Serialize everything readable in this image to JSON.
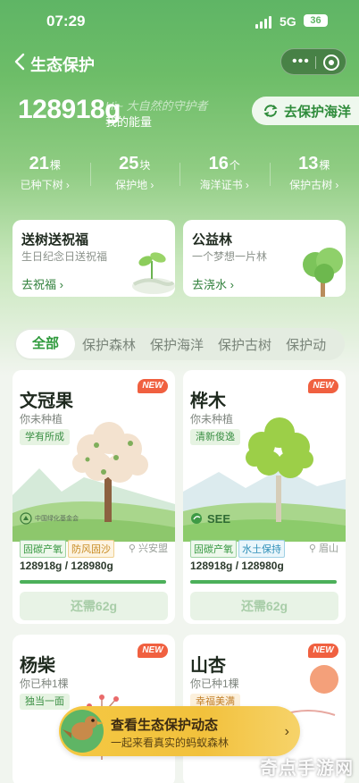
{
  "status": {
    "time": "07:29",
    "network": "5G",
    "battery": "36"
  },
  "nav": {
    "title": "生态保护"
  },
  "energy": {
    "value": "128918g",
    "greeting": "Hi~ 大自然的守护者",
    "label": "我的能量"
  },
  "ocean_button": {
    "label": "去保护海洋"
  },
  "stats": [
    {
      "value": "21",
      "unit": "棵",
      "label": "已种下树"
    },
    {
      "value": "25",
      "unit": "块",
      "label": "保护地"
    },
    {
      "value": "16",
      "unit": "个",
      "label": "海洋证书"
    },
    {
      "value": "13",
      "unit": "棵",
      "label": "保护古树"
    }
  ],
  "promos": [
    {
      "title": "送树送祝福",
      "subtitle": "生日纪念日送祝福",
      "action": "去祝福"
    },
    {
      "title": "公益林",
      "subtitle": "一个梦想一片林",
      "action": "去浇水"
    }
  ],
  "tabs": [
    "全部",
    "保护森林",
    "保护海洋",
    "保护古树",
    "保护动"
  ],
  "cards": [
    {
      "name": "文冠果",
      "status": "你未种植",
      "tag": "学有所成",
      "badge": "NEW",
      "org": "中国绿化基金会",
      "tags": [
        "固碳产氧",
        "防风固沙"
      ],
      "location": "兴安盟",
      "energy": "128918g",
      "separator": "/",
      "required": "128980g",
      "progress": 0.9995,
      "button": "还需62g"
    },
    {
      "name": "桦木",
      "status": "你未种植",
      "tag": "清新俊逸",
      "badge": "NEW",
      "org": "SEE",
      "tags": [
        "固碳产氧",
        "水土保持"
      ],
      "location": "眉山",
      "energy": "128918g",
      "separator": "/",
      "required": "128980g",
      "progress": 0.9995,
      "button": "还需62g"
    },
    {
      "name": "杨柴",
      "status": "你已种1棵",
      "tag": "独当一面",
      "badge": "NEW"
    },
    {
      "name": "山杏",
      "status": "你已种1棵",
      "tag": "幸福美满",
      "badge": "NEW"
    }
  ],
  "banner": {
    "title": "查看生态保护动态",
    "subtitle": "一起来看真实的蚂蚁森林"
  },
  "watermark": "奇点手游网",
  "colors": {
    "accent": "#4cb05a",
    "header": "#5fb565",
    "new_badge": "#f06040",
    "banner": "#f4c843"
  }
}
